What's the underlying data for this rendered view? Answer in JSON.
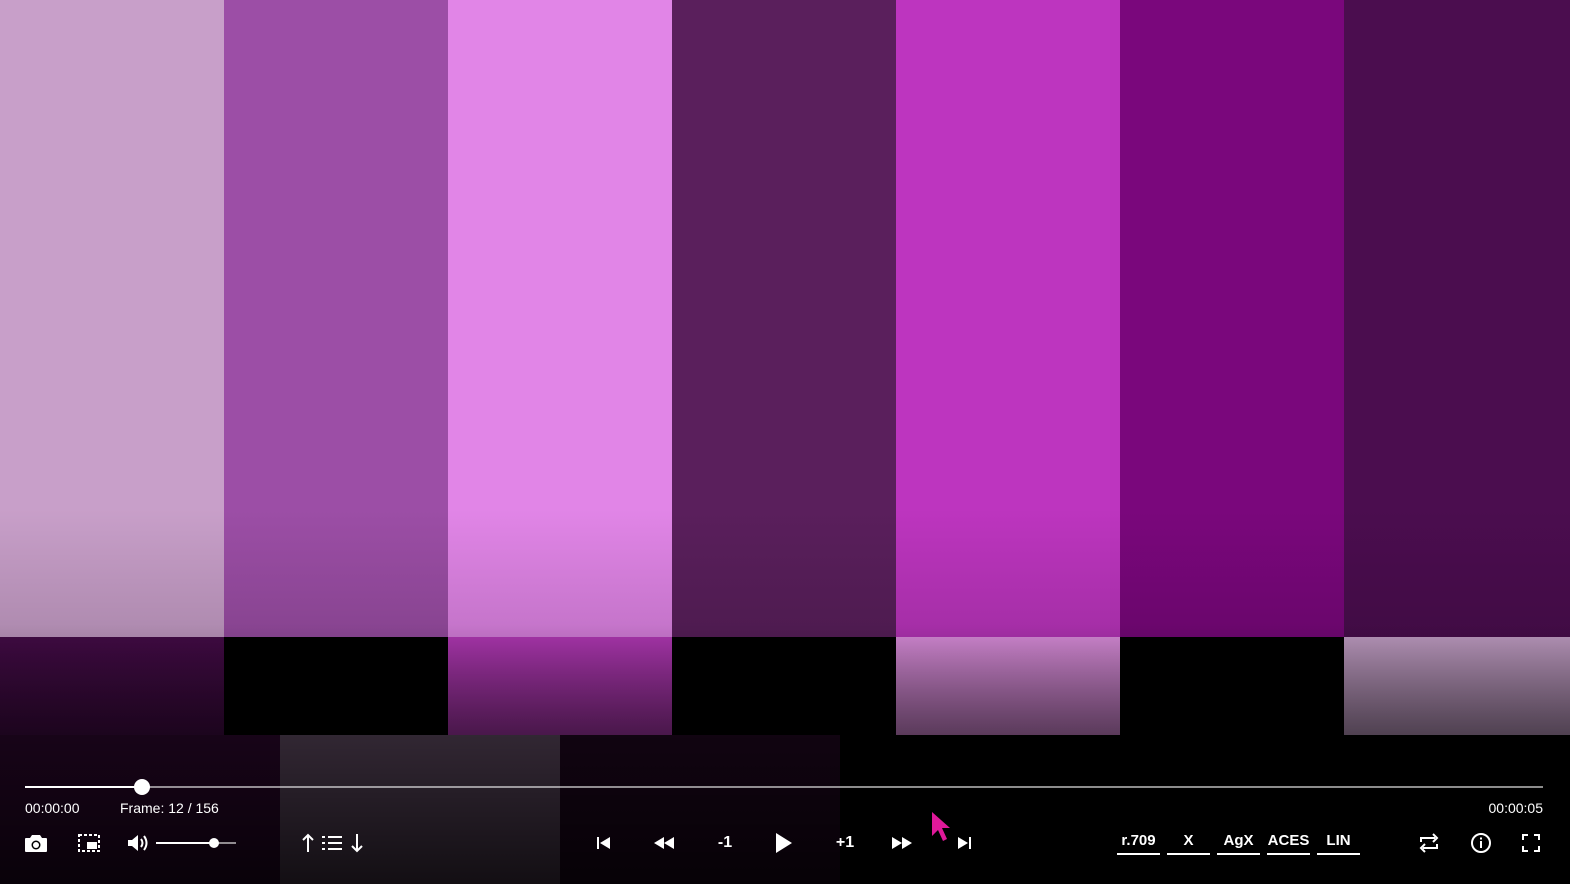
{
  "video": {
    "top_bars": [
      "#c89fc9",
      "#9c4ea6",
      "#e185e7",
      "#5a1f5c",
      "#bd35bf",
      "#7a077c",
      "#4b0d4f"
    ],
    "middle_bars": [
      "#3f0a42",
      "#000000",
      "#a534a8",
      "#000000",
      "#cb83cc",
      "#000000",
      "#b392b6"
    ],
    "bottom_bars": [
      "#230624",
      "#4a3a4c",
      "#190619",
      "#000000",
      "#000000",
      "#000000"
    ]
  },
  "player": {
    "current_time": "00:00:00",
    "frame_label": "Frame: 12 / 156",
    "current_frame": 12,
    "total_frames": 156,
    "duration": "00:00:05",
    "volume": 0.72
  },
  "buttons": {
    "step_back_label": "-1",
    "step_forward_label": "+1"
  },
  "color_modes": [
    "r.709",
    "X",
    "AgX",
    "ACES",
    "LIN"
  ],
  "icons": {
    "screenshot": "camera-icon",
    "region": "region-select-icon",
    "volume": "volume-icon",
    "up": "arrow-up-icon",
    "playlist": "list-icon",
    "down": "arrow-down-icon",
    "skip_start": "skip-to-start-icon",
    "rewind": "rewind-icon",
    "play": "play-icon",
    "fast_forward": "fast-forward-icon",
    "skip_end": "skip-to-end-icon",
    "loop": "loop-icon",
    "info": "info-icon",
    "fullscreen": "fullscreen-icon"
  },
  "colors": {
    "cursor": "#e0199a"
  }
}
